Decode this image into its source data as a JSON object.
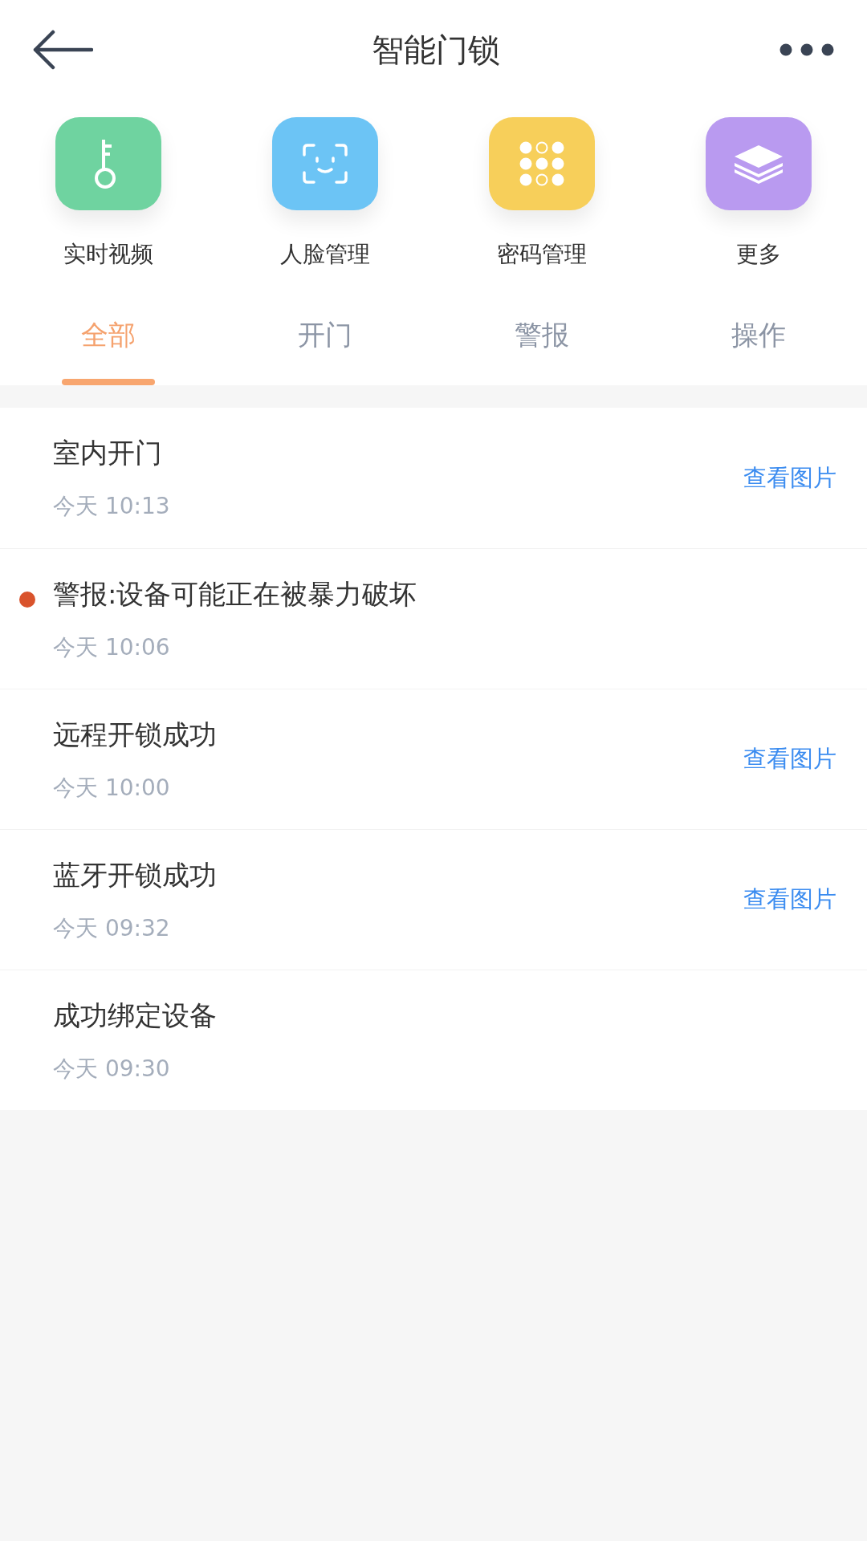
{
  "header": {
    "title": "智能门锁"
  },
  "shortcuts": [
    {
      "kind": "key",
      "label": "实时视频",
      "color": "#6fd3a0"
    },
    {
      "kind": "face",
      "label": "人脸管理",
      "color": "#6cc4f5"
    },
    {
      "kind": "keypad",
      "label": "密码管理",
      "color": "#f7cf5a"
    },
    {
      "kind": "layers",
      "label": "更多",
      "color": "#b99af0"
    }
  ],
  "tabs": [
    {
      "label": "全部",
      "selected": true
    },
    {
      "label": "开门",
      "selected": false
    },
    {
      "label": "警报",
      "selected": false
    },
    {
      "label": "操作",
      "selected": false
    }
  ],
  "records": [
    {
      "title": "室内开门",
      "time": "今天 10:13",
      "unread": false,
      "link": "查看图片"
    },
    {
      "title": "警报:设备可能正在被暴力破坏",
      "time": "今天 10:06",
      "unread": true
    },
    {
      "title": "远程开锁成功",
      "time": "今天 10:00",
      "unread": false,
      "link": "查看图片"
    },
    {
      "title": "蓝牙开锁成功",
      "time": "今天 09:32",
      "unread": false,
      "link": "查看图片"
    },
    {
      "title": "成功绑定设备",
      "time": "今天 09:30",
      "unread": false
    }
  ]
}
